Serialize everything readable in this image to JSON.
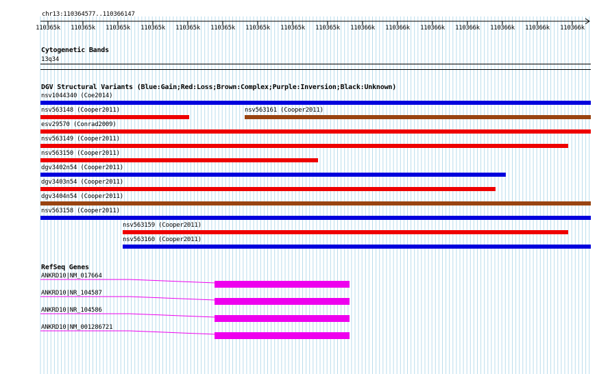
{
  "ruler": {
    "locus": "chr13:110364577..110366147",
    "ticks": [
      "110365k",
      "110365k",
      "110365k",
      "110365k",
      "110365k",
      "110365k",
      "110365k",
      "110365k",
      "110365k",
      "110366k",
      "110366k",
      "110366k",
      "110366k",
      "110366k",
      "110366k",
      "110366k"
    ]
  },
  "cytobands": {
    "title": "Cytogenetic Bands",
    "band": "13q34"
  },
  "dgv": {
    "title": "DGV Structural Variants (Blue:Gain;Red:Loss;Brown:Complex;Purple:Inversion;Black:Unknown)",
    "colors": {
      "gain": "#0000dd",
      "loss": "#ee0000",
      "complex": "#994411"
    },
    "variants": [
      {
        "label": "nsv1044340 (Coe2014)",
        "type": "gain"
      },
      {
        "label": "nsv563148 (Cooper2011)",
        "type": "loss"
      },
      {
        "label": "nsv563161 (Cooper2011)",
        "type": "complex"
      },
      {
        "label": "esv29570 (Conrad2009)",
        "type": "loss"
      },
      {
        "label": "nsv563149 (Cooper2011)",
        "type": "loss"
      },
      {
        "label": "nsv563150 (Cooper2011)",
        "type": "loss"
      },
      {
        "label": "dgv3402n54 (Cooper2011)",
        "type": "gain"
      },
      {
        "label": "dgv3403n54 (Cooper2011)",
        "type": "loss"
      },
      {
        "label": "dgv3404n54 (Cooper2011)",
        "type": "complex"
      },
      {
        "label": "nsv563158 (Cooper2011)",
        "type": "gain"
      },
      {
        "label": "nsv563159 (Cooper2011)",
        "type": "loss"
      },
      {
        "label": "nsv563160 (Cooper2011)",
        "type": "gain"
      }
    ]
  },
  "refseq": {
    "title": "RefSeq Genes",
    "color": "#ee00ee",
    "genes": [
      {
        "label": "ANKRD10|NM_017664"
      },
      {
        "label": "ANKRD10|NR_104587"
      },
      {
        "label": "ANKRD10|NR_104586"
      },
      {
        "label": "ANKRD10|NM_001286721"
      }
    ]
  }
}
